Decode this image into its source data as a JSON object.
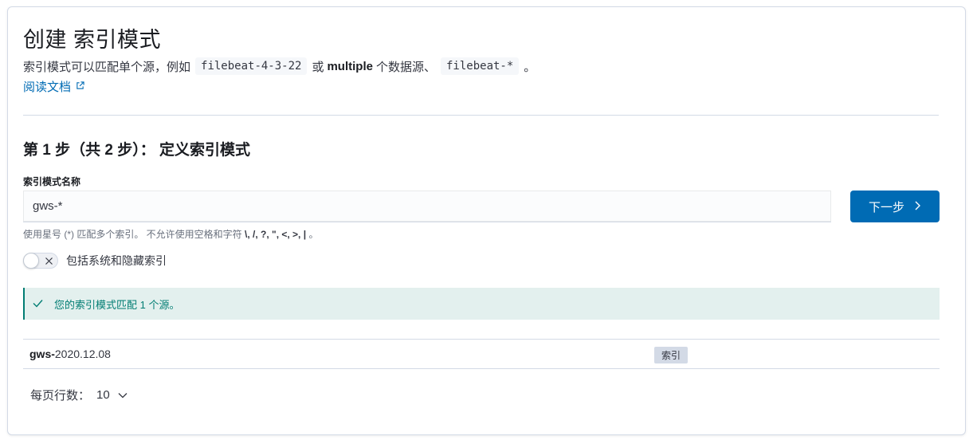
{
  "header": {
    "title": "创建 索引模式",
    "description": {
      "part1": "索引模式可以匹配单个源，例如",
      "code1": "filebeat-4-3-22",
      "part2": "或",
      "bold": "multiple",
      "part3": "个数据源、",
      "code2": "filebeat-*",
      "part4": "。"
    },
    "doc_link": "阅读文档",
    "doc_link_icon": "external-link-icon"
  },
  "step": {
    "title": "第 1 步（共 2 步）： 定义索引模式"
  },
  "form": {
    "field_label": "索引模式名称",
    "input_value": "gws-*",
    "help_prefix": "使用星号 (*) 匹配多个索引。 不允许使用空格和字符",
    "help_chars": "\\, /, ?, \", <, >, |",
    "help_suffix": "。",
    "next_button": "下一步",
    "next_icon": "chevron-right-icon"
  },
  "toggle": {
    "label": "包括系统和隐藏索引",
    "state": "off"
  },
  "callout": {
    "text": "您的索引模式匹配 1 个源。",
    "icon": "check-icon",
    "color": "#017d73"
  },
  "table": {
    "rows": [
      {
        "name_bold": "gws-",
        "name_rest": "2020.12.08",
        "badge": "索引"
      }
    ]
  },
  "pagination": {
    "label": "每页行数：",
    "value": "10"
  },
  "colors": {
    "primary": "#006bb4",
    "success": "#017d73",
    "success_bg": "#e3f0ee",
    "border": "#d3dae6"
  }
}
